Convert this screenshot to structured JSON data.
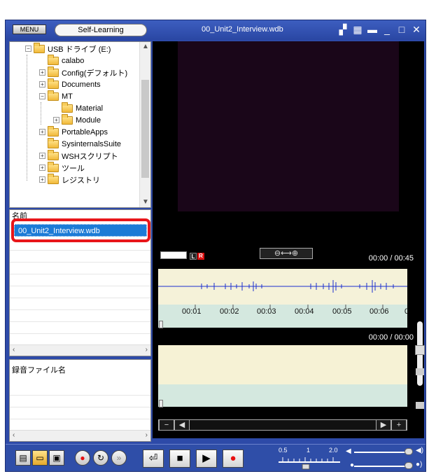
{
  "titlebar": {
    "menu_label": "MENU",
    "mode_label": "Self-Learning",
    "window_title": "00_Unit2_Interview.wdb",
    "icons": [
      "layout-icon",
      "grid-icon",
      "minimize-bar-icon",
      "minimize-icon",
      "maximize-icon",
      "close-icon"
    ]
  },
  "tree": {
    "items": [
      {
        "label": "USB ドライブ (E:)",
        "expander": "-",
        "level": 1
      },
      {
        "label": "calabo",
        "expander": "",
        "level": 2
      },
      {
        "label": "Config(デフォルト)",
        "expander": "+",
        "level": 2
      },
      {
        "label": "Documents",
        "expander": "+",
        "level": 2
      },
      {
        "label": "MT",
        "expander": "-",
        "level": 2
      },
      {
        "label": "Material",
        "expander": "",
        "level": 3
      },
      {
        "label": "Module",
        "expander": "+",
        "level": 3
      },
      {
        "label": "PortableApps",
        "expander": "+",
        "level": 2
      },
      {
        "label": "SysinternalsSuite",
        "expander": "",
        "level": 2
      },
      {
        "label": "WSHスクリプト",
        "expander": "+",
        "level": 2
      },
      {
        "label": "ツール",
        "expander": "+",
        "level": 2
      },
      {
        "label": "レジストリ",
        "expander": "+",
        "level": 2
      }
    ]
  },
  "filelist": {
    "column_header": "名前",
    "selected_file": "00_Unit2_Interview.wdb"
  },
  "reclist": {
    "column_header": "録音ファイル名"
  },
  "player": {
    "lr_left": "L",
    "lr_right": "R",
    "zoom_label": "⊖⟷⊕",
    "time_top": "00:00 / 00:45",
    "time_bottom": "00:00 / 00:00",
    "ticks": [
      "00:01",
      "00:02",
      "00:03",
      "00:04",
      "00:05",
      "00:06",
      "0"
    ]
  },
  "toolbar": {
    "speed_labels": [
      "0.5",
      "1",
      "2.0"
    ],
    "playback_speed": 1.0,
    "volume": 0.85,
    "mic_volume": 0.85
  },
  "colors": {
    "frame": "#2d4aa8",
    "selection": "#1c7bd6",
    "highlight_ring": "#e8161a",
    "wave_bg": "#f5f2d9",
    "timeline_bg": "#d4e8df",
    "waveform": "#1a2fd0",
    "record": "#e81010"
  }
}
